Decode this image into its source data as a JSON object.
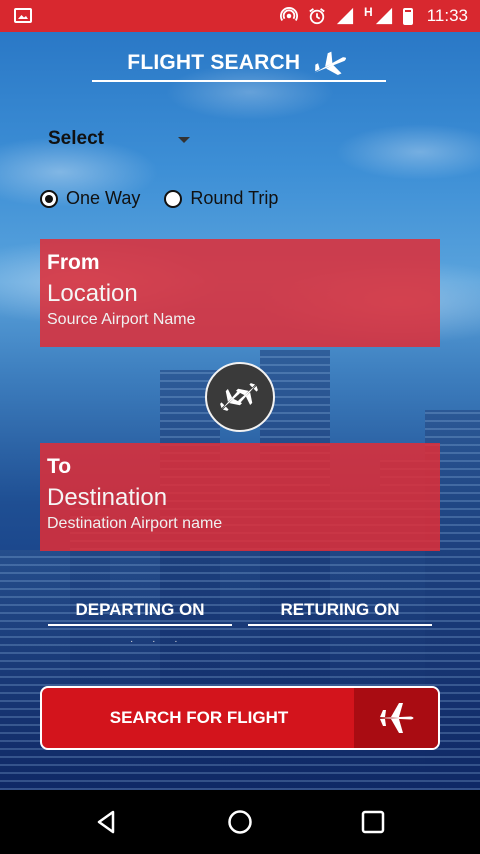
{
  "status_bar": {
    "time": "11:33",
    "network_type": "H"
  },
  "header": {
    "title": "FLIGHT SEARCH"
  },
  "select": {
    "value": "Select"
  },
  "trip_type": {
    "options": [
      {
        "label": "One Way",
        "checked": true
      },
      {
        "label": "Round Trip",
        "checked": false
      }
    ]
  },
  "from_card": {
    "caption": "From",
    "value": "Location",
    "hint": "Source Airport Name"
  },
  "to_card": {
    "caption": "To",
    "value": "Destination",
    "hint": "Destination Airport name"
  },
  "dates": {
    "departing_label": "DEPARTING ON",
    "returning_label": "RETURING ON",
    "placeholder": "· · ·"
  },
  "search_button": {
    "label": "SEARCH FOR FLIGHT"
  },
  "colors": {
    "accent_red": "#d8282f",
    "button_red": "#d3141c",
    "button_dark_red": "#a90c12"
  },
  "icons": [
    "image-icon",
    "hotspot-icon",
    "alarm-icon",
    "signal-icon",
    "battery-icon",
    "airplane-icon",
    "swap-planes-icon",
    "back-icon",
    "home-icon",
    "recents-icon"
  ]
}
